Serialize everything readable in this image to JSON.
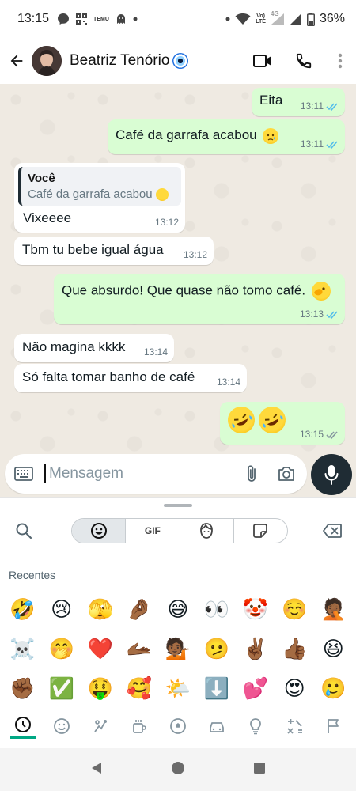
{
  "status_bar": {
    "time": "13:15",
    "net_label_1": "Vo)",
    "net_label_2": "LTE",
    "net_label_3": "4G",
    "battery": "36%",
    "app_badge": "TEMU"
  },
  "header": {
    "contact_name": "Beatriz Tenório"
  },
  "messages": [
    {
      "id": "m1",
      "direction": "out",
      "text": "Eita",
      "time": "13:11",
      "status": "read"
    },
    {
      "id": "m2",
      "direction": "out",
      "text": "Café da garrafa acabou",
      "emoji": "crying-face",
      "time": "13:11",
      "status": "read"
    },
    {
      "id": "m3",
      "direction": "in",
      "quote_author": "Você",
      "quote_text": "Café da garrafa acabou",
      "text": "Vixeeee",
      "time": "13:12"
    },
    {
      "id": "m4",
      "direction": "in",
      "text": "Tbm tu bebe igual água",
      "time": "13:12"
    },
    {
      "id": "m5",
      "direction": "out",
      "text": "Que absurdo! Que quase não tomo café.",
      "emoji": "face-peeking",
      "time": "13:13",
      "status": "read"
    },
    {
      "id": "m6",
      "direction": "in",
      "text": "Não magina kkkk",
      "time": "13:14"
    },
    {
      "id": "m7",
      "direction": "in",
      "text": "Só falta tomar banho de café",
      "time": "13:14"
    },
    {
      "id": "m8",
      "direction": "out",
      "emoji_only": [
        "rolling-laughing",
        "rolling-laughing"
      ],
      "time": "13:15",
      "status": "delivered"
    }
  ],
  "composer": {
    "placeholder": "Mensagem"
  },
  "emoji_keyboard": {
    "gif_label": "GIF",
    "recents_label": "Recentes",
    "recent_emojis": [
      "🤣",
      "😢",
      "🫣",
      "🤌🏾",
      "😅",
      "👀",
      "🤡",
      "☺️",
      "🤦🏾",
      "☠️",
      "🤭",
      "❤️",
      "🫴🏾",
      "💁🏾",
      "🫤",
      "✌🏾",
      "👍🏾",
      "😆",
      "✊🏾",
      "✅",
      "🤑",
      "🥰",
      "🌤️",
      "⬇️",
      "💕",
      "😍",
      "🥲"
    ],
    "categories": [
      "recent",
      "smileys",
      "people",
      "animals",
      "food",
      "activity",
      "travel",
      "objects",
      "symbols",
      "flags"
    ],
    "active_category": "recent"
  },
  "colors": {
    "outgoing_bubble": "#d9fdd3",
    "incoming_bubble": "#ffffff",
    "chat_background": "#efeae2",
    "read_ticks": "#53bdeb",
    "accent": "#00a884"
  }
}
